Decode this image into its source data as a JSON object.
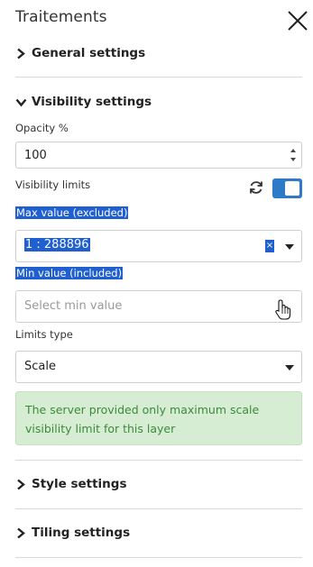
{
  "panel": {
    "title": "Traitements"
  },
  "sections": {
    "general": {
      "label": "General settings"
    },
    "visibility": {
      "label": "Visibility settings"
    },
    "style": {
      "label": "Style settings"
    },
    "tiling": {
      "label": "Tiling settings"
    }
  },
  "visibility": {
    "opacity_label": "Opacity %",
    "opacity_value": "100",
    "limits_label": "Visibility limits",
    "limits_enabled": true,
    "max_label": "Max value (excluded)",
    "max_value": "1 : 288896",
    "clear_symbol": "×",
    "min_label": "Min value (included)",
    "min_placeholder": "Select min value",
    "limits_type_label": "Limits type",
    "limits_type_value": "Scale",
    "info_message": "The server provided only maximum scale visibility limit for this layer"
  },
  "colors": {
    "accent": "#2f79c9",
    "selection": "#1f5fcf",
    "info_bg": "#d7edd3",
    "info_text": "#3b8a3c"
  }
}
